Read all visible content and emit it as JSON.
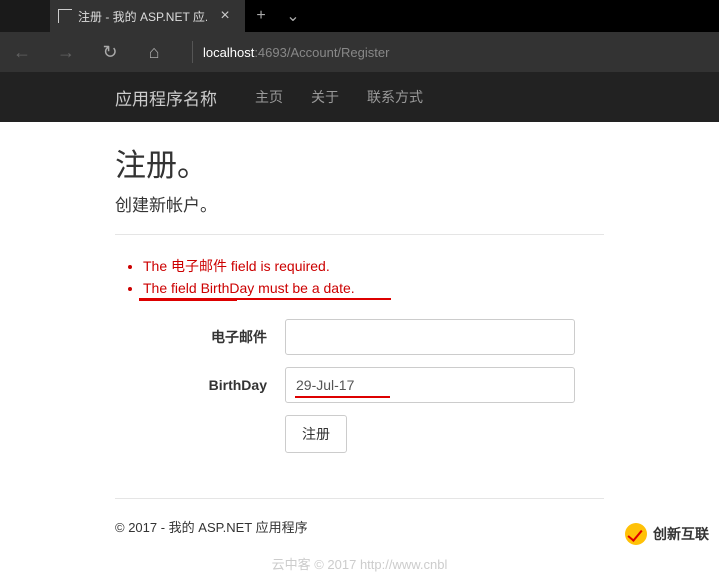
{
  "browser": {
    "tab_title": "注册 - 我的 ASP.NET 应...",
    "url_host": "localhost",
    "url_path": ":4693/Account/Register"
  },
  "nav": {
    "brand": "应用程序名称",
    "links": [
      "主页",
      "关于",
      "联系方式"
    ]
  },
  "page": {
    "heading": "注册。",
    "subtitle": "创建新帐户。",
    "errors": [
      "The 电子邮件 field is required.",
      "The field BirthDay must be a date."
    ],
    "fields": {
      "email_label": "电子邮件",
      "email_value": "",
      "birthday_label": "BirthDay",
      "birthday_value": "29-Jul-17"
    },
    "submit_label": "注册",
    "footer": "© 2017 - 我的 ASP.NET 应用程序",
    "watermark": "云中客 © 2017 http://www.cnbl",
    "badge": "创新互联"
  }
}
